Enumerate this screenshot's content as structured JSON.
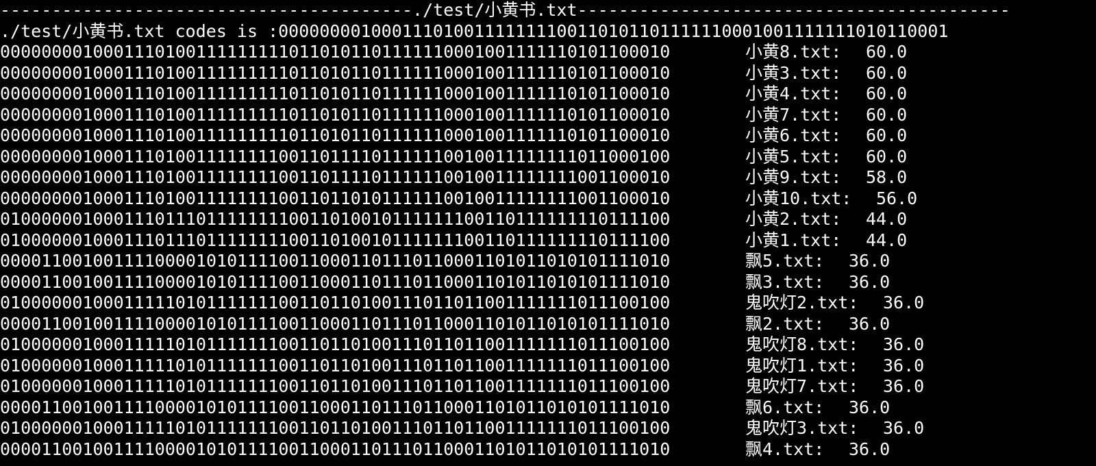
{
  "header": {
    "separator_line": "----------------------------------------./test/小黄书.txt------------------------------------------",
    "query_line": "./test/小黄书.txt codes is :00000000100011101001111111100110101101111110001001111111010110001"
  },
  "rows": [
    {
      "code": "00000000100011101001111111110110101101111110001001111110101100010",
      "file": "小黄8.txt:",
      "score": "60.0"
    },
    {
      "code": "00000000100011101001111111110110101101111110001001111110101100010",
      "file": "小黄3.txt:",
      "score": "60.0"
    },
    {
      "code": "00000000100011101001111111110110101101111110001001111110101100010",
      "file": "小黄4.txt:",
      "score": "60.0"
    },
    {
      "code": "00000000100011101001111111110110101101111110001001111110101100010",
      "file": "小黄7.txt:",
      "score": "60.0"
    },
    {
      "code": "00000000100011101001111111110110101101111110001001111110101100010",
      "file": "小黄6.txt:",
      "score": "60.0"
    },
    {
      "code": "00000000100011101001111111100110111101111110010011111111011000100",
      "file": "小黄5.txt:",
      "score": "60.0"
    },
    {
      "code": "00000000100011101001111111100110111101111110010011111111001100010",
      "file": "小黄9.txt:",
      "score": "58.0"
    },
    {
      "code": "00000000100011101001111111100110110101111110010011111111001100010",
      "file": "小黄10.txt:",
      "score": "56.0"
    },
    {
      "code": "01000000100011101110111111110011010010111111100110111111110111100",
      "file": "小黄2.txt:",
      "score": "44.0"
    },
    {
      "code": "01000000100011101110111111110011010010111111100110111111110111100",
      "file": "小黄1.txt:",
      "score": "44.0"
    },
    {
      "code": "00001100100111100001010111100110001101110110001101011010101111010",
      "file": "飘5.txt:",
      "score": "36.0"
    },
    {
      "code": "00001100100111100001010111100110001101110110001101011010101111010",
      "file": "飘3.txt:",
      "score": "36.0"
    },
    {
      "code": "01000000100011111010111111100110110100111011011001111111011100100",
      "file": "鬼吹灯2.txt:",
      "score": "36.0"
    },
    {
      "code": "00001100100111100001010111100110001101110110001101011010101111010",
      "file": "飘2.txt:",
      "score": "36.0"
    },
    {
      "code": "01000000100011111010111111100110110100111011011001111111011100100",
      "file": "鬼吹灯8.txt:",
      "score": "36.0"
    },
    {
      "code": "01000000100011111010111111100110110100111011011001111111011100100",
      "file": "鬼吹灯1.txt:",
      "score": "36.0"
    },
    {
      "code": "01000000100011111010111111100110110100111011011001111111011100100",
      "file": "鬼吹灯7.txt:",
      "score": "36.0"
    },
    {
      "code": "00001100100111100001010111100110001101110110001101011010101111010",
      "file": "飘6.txt:",
      "score": "36.0"
    },
    {
      "code": "01000000100011111010111111100110110100111011011001111111011100100",
      "file": "鬼吹灯3.txt:",
      "score": "36.0"
    },
    {
      "code": "00001100100111100001010111100110001101110110001101011010101111010",
      "file": "飘4.txt:",
      "score": "36.0"
    }
  ],
  "colors": {
    "background": "#000000",
    "foreground": "#ffffff"
  }
}
